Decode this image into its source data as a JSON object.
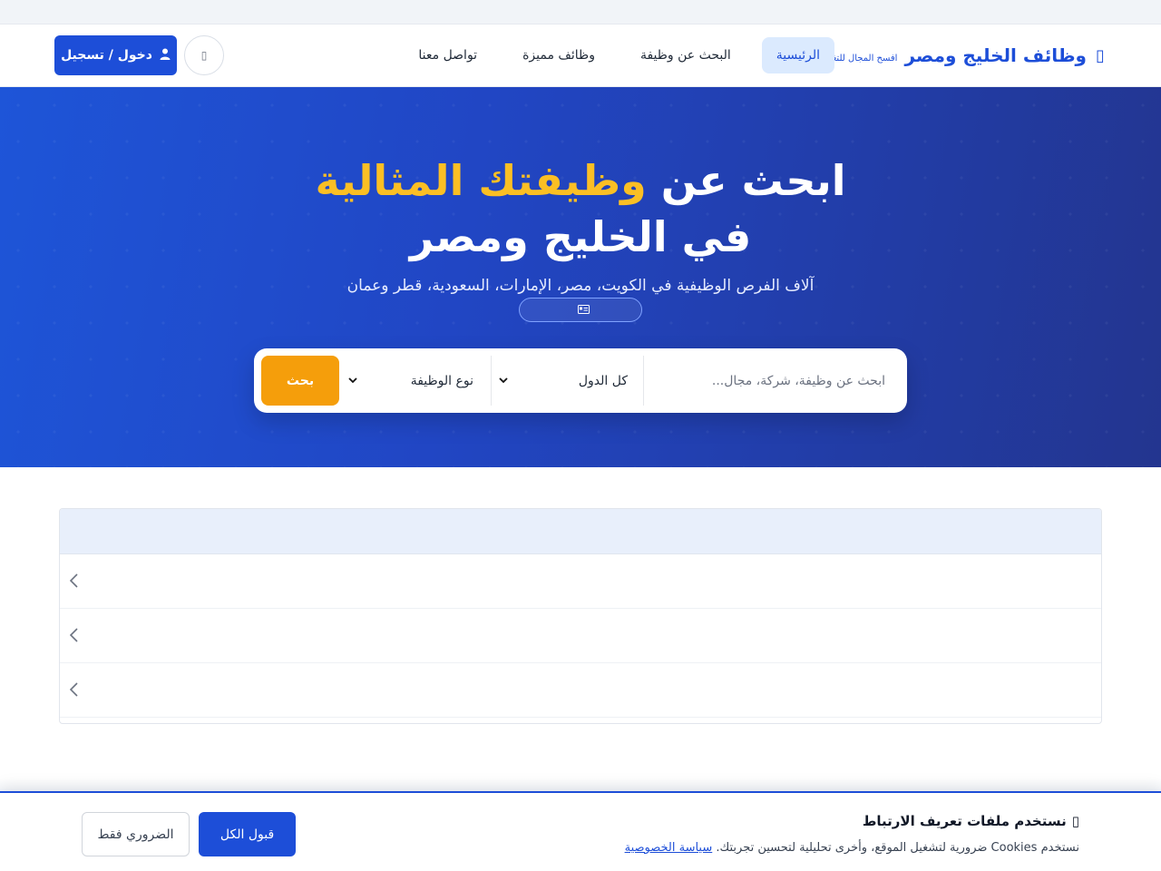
{
  "navbar": {
    "brand_name": "وظائف الخليج ومصر",
    "brand_tagline": "افسح المجال للتغيير",
    "links": [
      {
        "label": "الرئيسية",
        "active": true
      },
      {
        "label": "البحث عن وظيفة",
        "active": false
      },
      {
        "label": "وظائف مميزة",
        "active": false
      },
      {
        "label": "تواصل معنا",
        "active": false
      }
    ],
    "login_label": "دخول / تسجيل",
    "theme_icon": "moon-icon"
  },
  "hero": {
    "title_part1": "ابحث عن",
    "title_accent": "وظيفتك المثالية",
    "title_line2": "في الخليج ومصر",
    "subtitle": "آلاف الفرص الوظيفية في الكويت، مصر، الإمارات، السعودية، قطر وعمان",
    "badge_label": "",
    "search_placeholder": "ابحث عن وظيفة، شركة، مجال...",
    "country_select": "كل الدول",
    "type_select": "نوع الوظيفة",
    "search_button": "بحث"
  },
  "accordion": {
    "header": "",
    "rows": [
      {
        "label": ""
      },
      {
        "label": ""
      },
      {
        "label": ""
      }
    ]
  },
  "cookie": {
    "title": "نستخدم ملفات تعريف الارتباط",
    "text": "نستخدم Cookies ضرورية لتشغيل الموقع، وأخرى تحليلية لتحسين تجربتك.",
    "privacy_link": "سياسة الخصوصية",
    "accept_all": "قبول الكل",
    "essential_only": "الضروري فقط"
  },
  "colors": {
    "primary": "#1d4ed8",
    "accent": "#fbbf24",
    "search_button": "#f59e0b"
  }
}
